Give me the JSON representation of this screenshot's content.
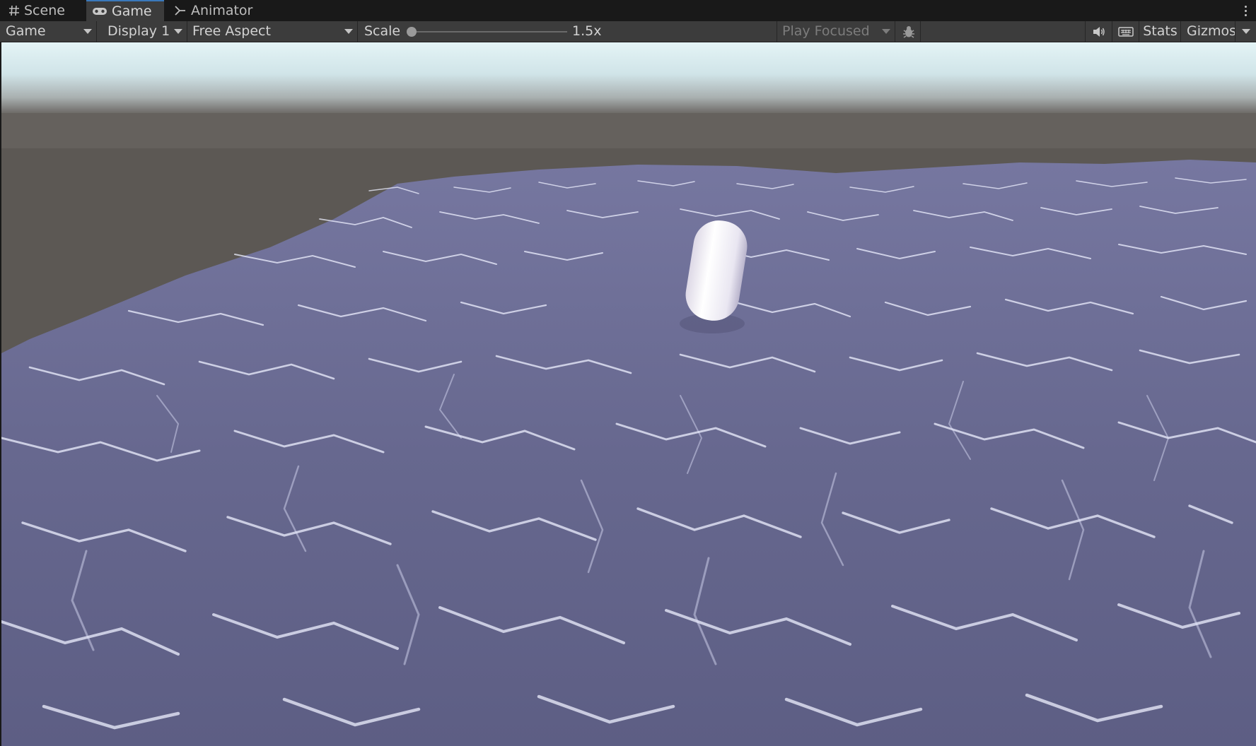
{
  "tabs": [
    {
      "label": "Scene",
      "icon": "grid-hash-icon"
    },
    {
      "label": "Game",
      "icon": "gamepad-icon",
      "active": true
    },
    {
      "label": "Animator",
      "icon": "animator-branch-icon"
    }
  ],
  "toolbar": {
    "game_view_mode": "Game",
    "display": "Display 1",
    "aspect": "Free Aspect",
    "scale_label": "Scale",
    "scale_value": "1.5x",
    "scale_slider_position": 0,
    "play_mode": "Play Focused",
    "stats_label": "Stats",
    "gizmos_label": "Gizmos",
    "icons": [
      "bug-icon",
      "speaker-icon",
      "keyboard-icon",
      "kebab-menu-icon"
    ]
  },
  "viewport": {
    "sky_top": "#e4f4f6",
    "horizon_ground": "#5c5854",
    "water_color": "#6a6b92",
    "foam_color": "#eef0ff",
    "object": "capsule",
    "object_color": "#f2f0f6"
  }
}
